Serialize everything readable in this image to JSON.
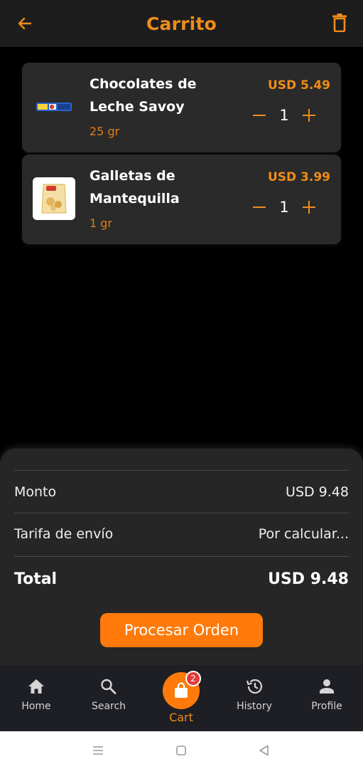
{
  "header": {
    "title": "Carrito",
    "back_icon": "arrow-left-icon",
    "trash_icon": "trash-icon"
  },
  "colors": {
    "accent": "#f08c1a",
    "button": "#ff7a0a",
    "card": "#2a2a2a",
    "badge": "#e03b3b"
  },
  "cart_items": [
    {
      "name": "Chocolates de Leche Savoy",
      "size": "25 gr",
      "price": "USD 5.49",
      "quantity": "1"
    },
    {
      "name": "Galletas de Mantequilla",
      "size": "1 gr",
      "price": "USD 3.99",
      "quantity": "1"
    }
  ],
  "summary": {
    "amount_label": "Monto",
    "amount_value": "USD 9.48",
    "shipping_label": "Tarifa de envío",
    "shipping_value": "Por calcular...",
    "total_label": "Total",
    "total_value": "USD 9.48",
    "process_button": "Procesar Orden"
  },
  "bottom_nav": {
    "home": "Home",
    "search": "Search",
    "cart": "Cart",
    "cart_badge": "2",
    "history": "History",
    "profile": "Profile"
  }
}
